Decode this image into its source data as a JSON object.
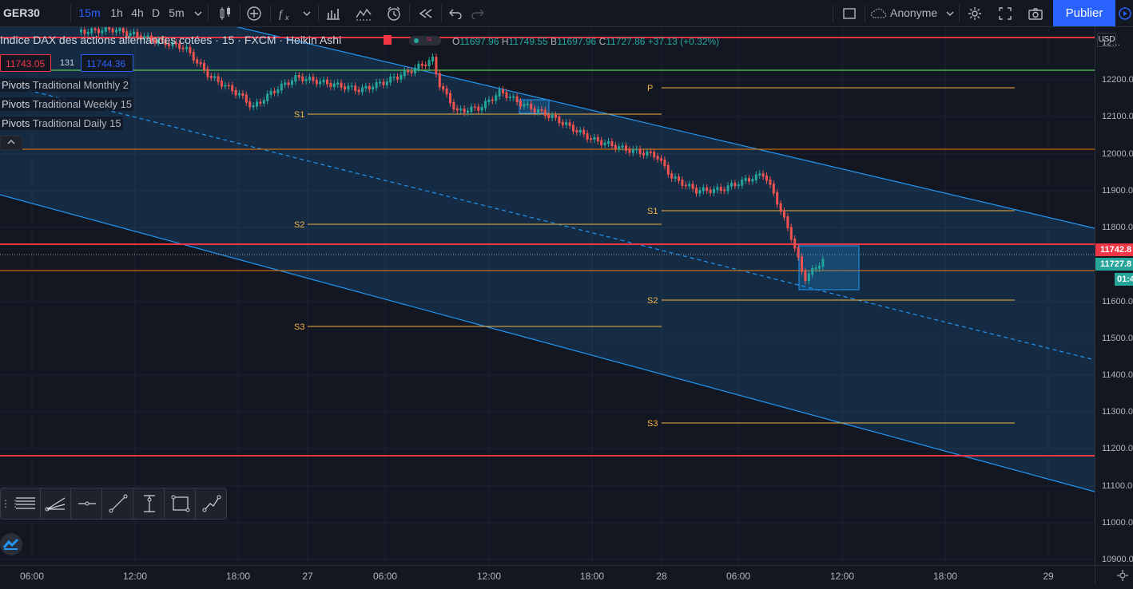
{
  "toolbar": {
    "symbol": "GER30",
    "intervals": [
      "15m",
      "1h",
      "4h",
      "D",
      "5m"
    ],
    "active_interval": "15m",
    "user": "Anonyme",
    "publish_label": "Publier"
  },
  "legend": {
    "title": "Indice DAX des actions allemandes cotées · 15 · FXCM · Heikin Ashi",
    "open_label": "O",
    "open": "11697.96",
    "high_label": "H",
    "high": "11749.55",
    "low_label": "B",
    "low": "11697.96",
    "close_label": "C",
    "close": "11727.86",
    "change": "+37.13 (+0.32%)",
    "sell_price": "11743.05",
    "spread": "131",
    "buy_price": "11744.36"
  },
  "pivots": [
    {
      "name": "Pivots",
      "desc": "Traditional Monthly 2"
    },
    {
      "name": "Pivots",
      "desc": "Traditional Weekly 15"
    },
    {
      "name": "Pivots",
      "desc": "Traditional Daily 15"
    }
  ],
  "pivot_level_labels": {
    "p": "P",
    "s1": "S1",
    "s2": "S2",
    "s3": "S3"
  },
  "price_scale": {
    "currency": "USD",
    "labels": [
      "12…",
      "12200.0",
      "12100.0",
      "12000.0",
      "11900.0",
      "11800.0",
      "11600.0",
      "11500.0",
      "11400.0",
      "11300.0",
      "11200.0",
      "11100.0",
      "11000.0",
      "10900.0"
    ],
    "tag_red": "11742.8",
    "tag_green": "11727.8",
    "countdown": "01:4"
  },
  "time_scale": {
    "labels": [
      "06:00",
      "12:00",
      "18:00",
      "27",
      "06:00",
      "12:00",
      "18:00",
      "28",
      "06:00",
      "12:00",
      "18:00",
      "29"
    ]
  },
  "colors": {
    "bg": "#131722",
    "up": "#26a69a",
    "down": "#ef5350",
    "channel": "#2196f3",
    "pivot": "#f5b342",
    "red_line": "#f23645",
    "green_line": "#4caf50",
    "accent": "#2962ff"
  }
}
